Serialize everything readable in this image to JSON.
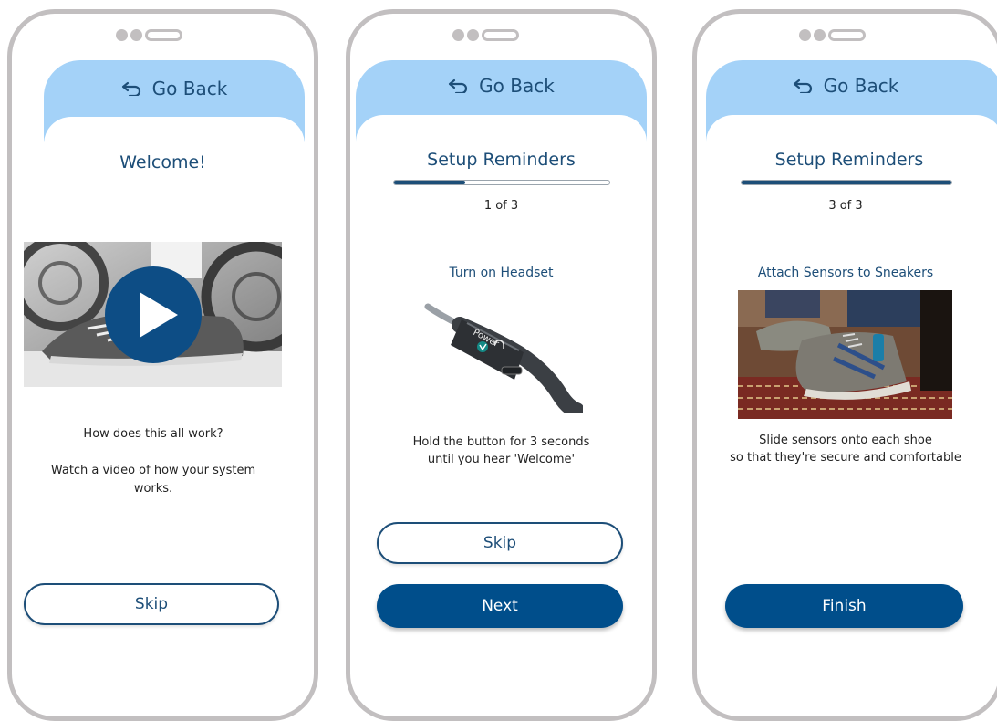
{
  "colors": {
    "frame": "#c2bfc0",
    "header": "#a4d2f8",
    "primary": "#004e8b",
    "text_blue": "#1d4e78"
  },
  "screens": [
    {
      "header": {
        "back_label": "Go Back",
        "icon": "back-arrow-icon"
      },
      "title": "Welcome!",
      "video": {
        "icon": "play-icon"
      },
      "body_line1": "How does this all work?",
      "body_line2": "Watch a video of how your system works.",
      "skip_label": "Skip"
    },
    {
      "header": {
        "back_label": "Go Back",
        "icon": "back-arrow-icon"
      },
      "title": "Setup Reminders",
      "progress": 0.33,
      "step_label": "1 of 3",
      "subhead": "Turn on Headset",
      "device_label": "Power",
      "body_line1": "Hold the button for 3 seconds",
      "body_line2": "until you hear 'Welcome'",
      "skip_label": "Skip",
      "next_label": "Next"
    },
    {
      "header": {
        "back_label": "Go Back",
        "icon": "back-arrow-icon"
      },
      "title": "Setup Reminders",
      "progress": 1.0,
      "step_label": "3 of 3",
      "subhead": "Attach Sensors to Sneakers",
      "body_line1": "Slide sensors onto each shoe",
      "body_line2": "so that they're secure and comfortable",
      "finish_label": "Finish"
    }
  ]
}
